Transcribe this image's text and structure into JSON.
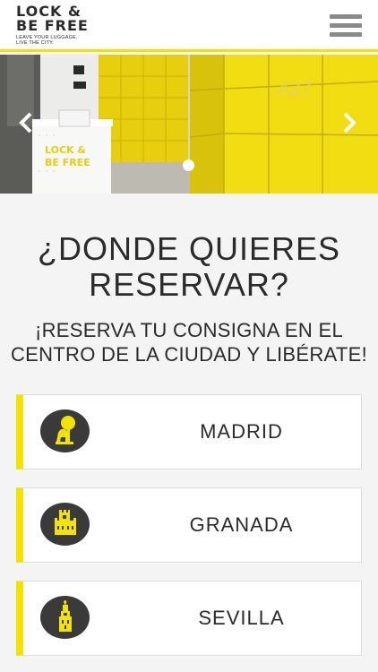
{
  "header": {
    "logo_line1": "LOCK &",
    "logo_line2": "BE FREE",
    "logo_tagline_1": "LEAVE YOUR LUGGAGE.",
    "logo_tagline_2": "LIVE THE CITY."
  },
  "hero": {
    "desk_text_1": "LOCK &",
    "desk_text_2": "BE FREE",
    "locker_number": "A27",
    "active_slide": 1,
    "slide_count": 1
  },
  "main": {
    "title_line1": "¿DONDE QUIERES",
    "title_line2": "RESERVAR?",
    "subtitle_line1": "¡RESERVA TU CONSIGNA EN EL",
    "subtitle_line2": "CENTRO DE LA CIUDAD Y LIBÉRATE!"
  },
  "cities": [
    {
      "name": "MADRID",
      "icon": "bear-strawberry-tree-icon"
    },
    {
      "name": "GRANADA",
      "icon": "alhambra-fortress-icon"
    },
    {
      "name": "SEVILLA",
      "icon": "giralda-tower-icon"
    }
  ],
  "colors": {
    "accent_yellow": "#f3e400",
    "text_dark": "#2b2b2b",
    "badge_dark": "#3a3a3a",
    "background": "#f4f4f4"
  }
}
